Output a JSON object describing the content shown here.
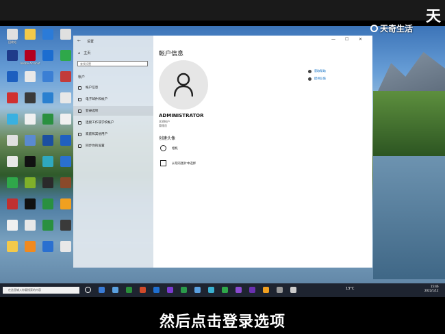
{
  "brand": {
    "small": "天奇生活",
    "big": "天"
  },
  "desktop": {
    "icons": [
      {
        "label": "回收站",
        "c": "#e0e0e0"
      },
      {
        "label": "",
        "c": "#f3c94a"
      },
      {
        "label": "",
        "c": "#2b7bd8"
      },
      {
        "label": "",
        "c": "#e0e0e0"
      },
      {
        "label": "",
        "c": "#1f3b8a"
      },
      {
        "label": "Adobe Acrobat",
        "c": "#b3001f"
      },
      {
        "label": "",
        "c": "#1c6dd0"
      },
      {
        "label": "",
        "c": "#2fa84a"
      },
      {
        "label": "",
        "c": "#1d5fbf"
      },
      {
        "label": "",
        "c": "#e8e8e8"
      },
      {
        "label": "",
        "c": "#3b7fd4"
      },
      {
        "label": "",
        "c": "#c23b3b"
      },
      {
        "label": "",
        "c": "#d03030"
      },
      {
        "label": "",
        "c": "#3a3a3a"
      },
      {
        "label": "",
        "c": "#2a80d0"
      },
      {
        "label": "",
        "c": "#e8e8e8"
      },
      {
        "label": "",
        "c": "#3ab0e0"
      },
      {
        "label": "",
        "c": "#f0f0f0"
      },
      {
        "label": "",
        "c": "#2a9040"
      },
      {
        "label": "",
        "c": "#f0f0f0"
      },
      {
        "label": "",
        "c": "#e0e0e0"
      },
      {
        "label": "",
        "c": "#5a8ad0"
      },
      {
        "label": "",
        "c": "#1b4fa0"
      },
      {
        "label": "",
        "c": "#2060c0"
      },
      {
        "label": "",
        "c": "#e8e8e8"
      },
      {
        "label": "",
        "c": "#111"
      },
      {
        "label": "",
        "c": "#2fa8c0"
      },
      {
        "label": "",
        "c": "#2a70d0"
      },
      {
        "label": "",
        "c": "#2fa84a"
      },
      {
        "label": "",
        "c": "#7fb02a"
      },
      {
        "label": "",
        "c": "#2a2a2a"
      },
      {
        "label": "",
        "c": "#8a4a2a"
      },
      {
        "label": "",
        "c": "#c03030"
      },
      {
        "label": "",
        "c": "#111"
      },
      {
        "label": "",
        "c": "#2a9040"
      },
      {
        "label": "",
        "c": "#f0a020"
      },
      {
        "label": "",
        "c": "#f0f0f0"
      },
      {
        "label": "",
        "c": "#e8e8e8"
      },
      {
        "label": "",
        "c": "#2a9040"
      },
      {
        "label": "",
        "c": "#3a3a3a"
      },
      {
        "label": "",
        "c": "#f3c94a"
      },
      {
        "label": "",
        "c": "#f08a20"
      },
      {
        "label": "",
        "c": "#2a70d0"
      },
      {
        "label": "",
        "c": "#e8e8e8"
      }
    ]
  },
  "settings": {
    "window_title": "设置",
    "home_label": "主页",
    "search_placeholder": "查找设置",
    "section_label": "帐户",
    "nav": [
      {
        "label": "帐户信息",
        "icon": "person-icon"
      },
      {
        "label": "电子邮件和帐户",
        "icon": "mail-icon"
      },
      {
        "label": "登录选项",
        "icon": "key-icon"
      },
      {
        "label": "连接工作或学校帐户",
        "icon": "briefcase-icon"
      },
      {
        "label": "家庭和其他用户",
        "icon": "people-icon"
      },
      {
        "label": "同步你的设置",
        "icon": "sync-icon"
      }
    ],
    "selected_index": 2,
    "page_title": "帐户信息",
    "username": "ADMINISTRATOR",
    "account_type": "本地帐户",
    "account_role": "管理员",
    "create_avatar_label": "创建头像",
    "options": [
      {
        "label": "相机",
        "icon": "camera-icon"
      },
      {
        "label": "从现有图片中选择",
        "icon": "image-icon"
      }
    ],
    "right_links": [
      {
        "label": "获取帮助"
      },
      {
        "label": "提供反馈"
      }
    ]
  },
  "taskbar": {
    "search_placeholder": "在这里输入你要搜索的内容",
    "weather": "13°C",
    "clock_time": "15:46",
    "clock_date": "2022/1/12"
  },
  "subtitle": "然后点击登录选项"
}
